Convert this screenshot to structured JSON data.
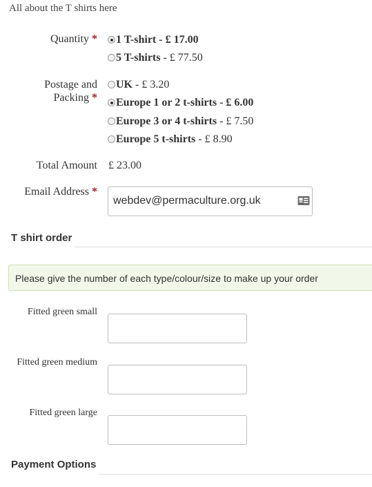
{
  "intro": "All about the T shirts here",
  "quantity": {
    "label": "Quantity",
    "required_mark": "*",
    "options": [
      {
        "name": "1 T-shirt",
        "price": " - £ 17.00",
        "selected": true
      },
      {
        "name": "5 T-shirts",
        "price": " - £ 77.50",
        "selected": false
      }
    ]
  },
  "postage": {
    "label_line1": "Postage and",
    "label_line2": "Packing",
    "required_mark": "*",
    "options": [
      {
        "name": "UK",
        "price": " - £ 3.20",
        "selected": false
      },
      {
        "name": "Europe 1 or 2 t-shirts",
        "price": " - £ 6.00",
        "selected": true
      },
      {
        "name": "Europe 3 or 4 t-shirts",
        "price": " - £ 7.50",
        "selected": false
      },
      {
        "name": "Europe 5 t-shirts",
        "price": " - £ 8.90",
        "selected": false
      }
    ]
  },
  "total": {
    "label": "Total Amount",
    "value": "£ 23.00"
  },
  "email": {
    "label": "Email Address",
    "required_mark": "*",
    "value": "webdev@permaculture.org.uk",
    "icon": "contact-card-icon"
  },
  "tshirt_order": {
    "title": "T shirt order",
    "notice": "Please give the number of each type/colour/size to make up your order",
    "fields": [
      {
        "label": "Fitted green small",
        "value": ""
      },
      {
        "label": "Fitted green medium",
        "value": ""
      },
      {
        "label": "Fitted green large",
        "value": ""
      }
    ]
  },
  "payment": {
    "title": "Payment Options"
  }
}
